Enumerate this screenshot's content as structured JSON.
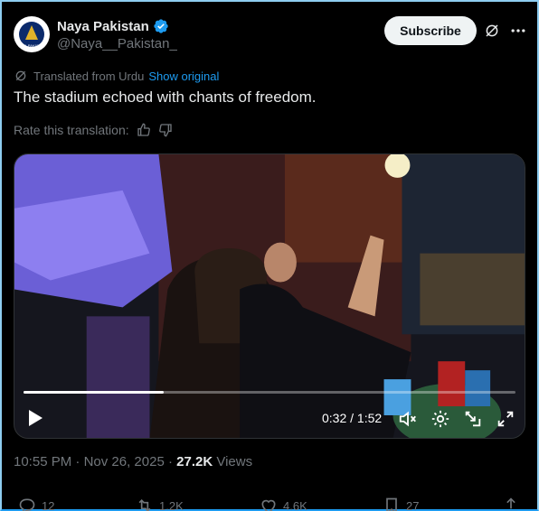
{
  "author": {
    "name": "Naya Pakistan",
    "handle": "@Naya__Pakistan_",
    "avatar_text": "NAYA PAKISTAN"
  },
  "header": {
    "subscribe_label": "Subscribe"
  },
  "translation": {
    "label": "Translated from Urdu",
    "show_original": "Show original",
    "rate_label": "Rate this translation:"
  },
  "tweet": {
    "text": "The stadium echoed with chants of freedom."
  },
  "video": {
    "time": "0:32 / 1:52",
    "progress": 0.285
  },
  "meta": {
    "time": "10:55 PM",
    "sep1": " · ",
    "date": "Nov 26, 2025",
    "sep2": " · ",
    "views_count": "27.2K",
    "views_label": " Views"
  },
  "actions": {
    "replies": "12",
    "reposts": "1.2K",
    "likes": "4.6K",
    "bookmarks": "27"
  },
  "colors": {
    "accent": "#1d9bf0",
    "bg": "#000000",
    "text": "#e7e9ea",
    "muted": "#71767b"
  }
}
